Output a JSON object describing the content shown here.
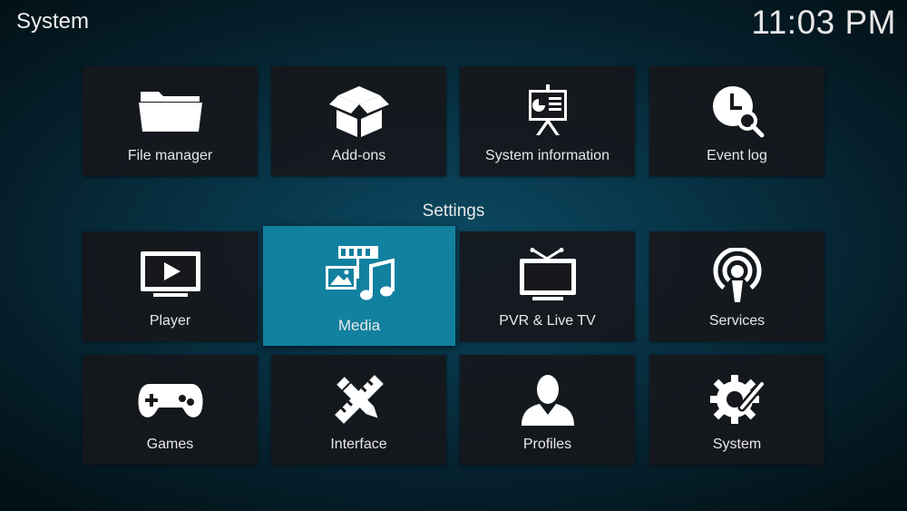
{
  "header": {
    "title": "System",
    "clock": "11:03 PM"
  },
  "top_row": [
    {
      "label": "File manager",
      "icon": "folder-icon"
    },
    {
      "label": "Add-ons",
      "icon": "open-box-icon"
    },
    {
      "label": "System information",
      "icon": "presentation-board-icon"
    },
    {
      "label": "Event log",
      "icon": "clock-search-icon"
    }
  ],
  "settings": {
    "heading": "Settings",
    "row1": [
      {
        "label": "Player",
        "icon": "tv-play-icon"
      },
      {
        "label": "Media",
        "icon": "media-library-icon",
        "focused": true
      },
      {
        "label": "PVR & Live TV",
        "icon": "antenna-tv-icon"
      },
      {
        "label": "Services",
        "icon": "broadcast-icon"
      }
    ],
    "row2": [
      {
        "label": "Games",
        "icon": "gamepad-icon"
      },
      {
        "label": "Interface",
        "icon": "pencil-ruler-icon"
      },
      {
        "label": "Profiles",
        "icon": "person-icon"
      },
      {
        "label": "System",
        "icon": "gear-wrench-icon"
      }
    ]
  },
  "colors": {
    "focus": "#12809f",
    "tile": "#16181c",
    "background": "#083447"
  }
}
